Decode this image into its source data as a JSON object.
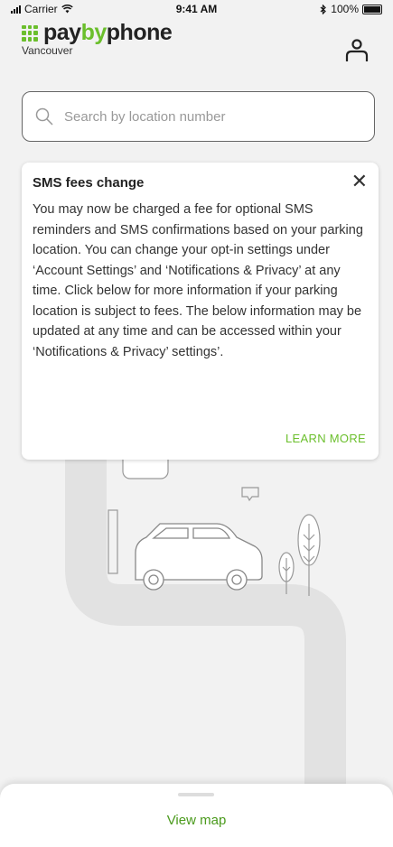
{
  "status_bar": {
    "carrier": "Carrier",
    "time": "9:41 AM",
    "battery": "100%"
  },
  "header": {
    "logo": {
      "part1": "pay",
      "part2": "by",
      "part3": "phone"
    },
    "city": "Vancouver"
  },
  "search": {
    "placeholder": "Search by location number"
  },
  "notice": {
    "title": "SMS fees change",
    "body": "You may now be charged a fee for optional SMS reminders and SMS confirmations based on your parking location. You can change your opt-in settings under ‘Account Settings’ and ‘Notifications & Privacy’ at any time. Click below for more information if your parking location is subject to fees. The below information may be updated at any time and can be accessed within your ‘Notifications & Privacy’ settings’.",
    "link": "LEARN MORE"
  },
  "bottom_sheet": {
    "view_map": "View map"
  },
  "colors": {
    "brand_green": "#6bbf2c",
    "link_green": "#4a9a1c"
  },
  "icons": [
    "wifi-icon",
    "bluetooth-icon",
    "account-icon",
    "search-icon",
    "close-icon"
  ]
}
